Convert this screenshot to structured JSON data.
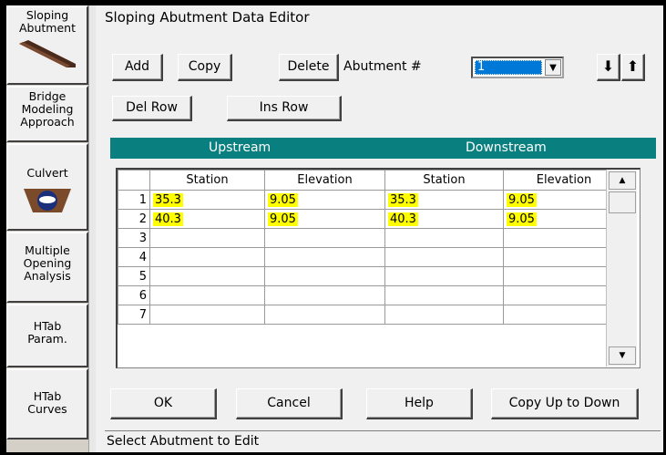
{
  "sidebar": {
    "sloping_label": "Sloping\nAbutment",
    "bridge_label": "Bridge\nModeling\nApproach",
    "culvert_label": "Culvert",
    "multiple_label": "Multiple\nOpening\nAnalysis",
    "htab_param_label": "HTab\nParam.",
    "htab_curves_label": "HTab\nCurves"
  },
  "title": "Sloping Abutment Data Editor",
  "toolbar": {
    "add": "Add",
    "copy": "Copy",
    "delete": "Delete",
    "abutment_label": "Abutment #",
    "abutment_value": "1",
    "down_arrow": "⬇",
    "up_arrow": "⬆",
    "del_row": "Del Row",
    "ins_row": "Ins Row"
  },
  "header": {
    "upstream": "Upstream",
    "downstream": "Downstream"
  },
  "columns": [
    "Station",
    "Elevation",
    "Station",
    "Elevation"
  ],
  "rows": [
    {
      "num": "1",
      "us_station": "35.3",
      "us_elev": "9.05",
      "ds_station": "35.3",
      "ds_elev": "9.05"
    },
    {
      "num": "2",
      "us_station": "40.3",
      "us_elev": "9.05",
      "ds_station": "40.3",
      "ds_elev": "9.05"
    },
    {
      "num": "3",
      "us_station": "",
      "us_elev": "",
      "ds_station": "",
      "ds_elev": ""
    },
    {
      "num": "4",
      "us_station": "",
      "us_elev": "",
      "ds_station": "",
      "ds_elev": ""
    },
    {
      "num": "5",
      "us_station": "",
      "us_elev": "",
      "ds_station": "",
      "ds_elev": ""
    },
    {
      "num": "6",
      "us_station": "",
      "us_elev": "",
      "ds_station": "",
      "ds_elev": ""
    },
    {
      "num": "7",
      "us_station": "",
      "us_elev": "",
      "ds_station": "",
      "ds_elev": ""
    }
  ],
  "footer": {
    "ok": "OK",
    "cancel": "Cancel",
    "help": "Help",
    "copy_up_down": "Copy Up to Down"
  },
  "status": "Select Abutment to Edit",
  "colors": {
    "header_bar": "#0a7f7f",
    "highlight": "#ffff00",
    "selection": "#0078d7"
  }
}
